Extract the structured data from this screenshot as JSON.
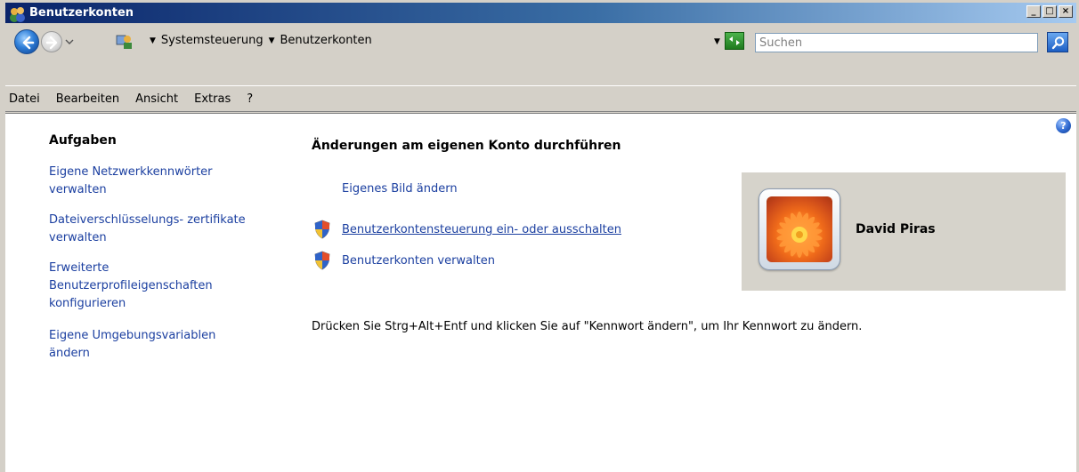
{
  "window": {
    "title": "Benutzerkonten",
    "controls": {
      "minimize": "_",
      "maximize": "□",
      "close": "×"
    }
  },
  "addressbar": {
    "breadcrumb": [
      "Systemsteuerung",
      "Benutzerkonten"
    ],
    "search_placeholder": "Suchen"
  },
  "menu": [
    "Datei",
    "Bearbeiten",
    "Ansicht",
    "Extras",
    "?"
  ],
  "sidebar": {
    "title": "Aufgaben",
    "links": [
      "Eigene Netzwerkkennwörter verwalten",
      "Dateiverschlüsselungs- zertifikate verwalten",
      "Erweiterte Benutzerprofileigenschaften konfigurieren",
      "Eigene Umgebungsvariablen ändern"
    ]
  },
  "main": {
    "title": "Änderungen am eigenen Konto durchführen",
    "actions": [
      {
        "label": "Eigenes Bild ändern",
        "icon": "none"
      },
      {
        "label": "Benutzerkontensteuerung ein- oder ausschalten",
        "icon": "uac-shield-icon"
      },
      {
        "label": "Benutzerkonten verwalten",
        "icon": "uac-shield-icon"
      }
    ],
    "note": "Drücken Sie Strg+Alt+Entf und klicken Sie auf \"Kennwort ändern\", um Ihr Kennwort zu ändern."
  },
  "user": {
    "name": "David Piras",
    "picture": "flower-user-picture"
  },
  "colors": {
    "title_gradient_start": "#0a246a",
    "title_gradient_end": "#a6caf0",
    "link": "#1b3fa0",
    "panel": "#d6d3cb"
  }
}
